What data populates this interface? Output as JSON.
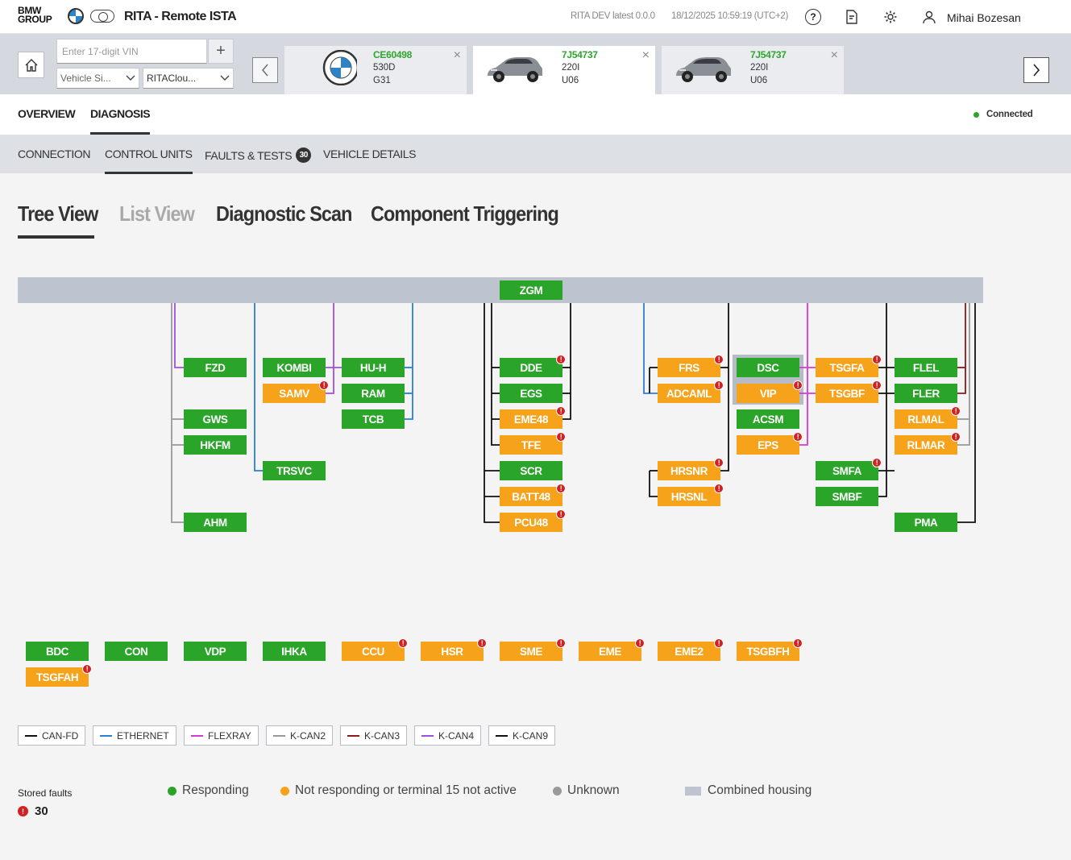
{
  "header": {
    "brand": "BMW\nGROUP",
    "app_title": "RITA - Remote ISTA",
    "environment": "RITA DEV latest 0.0.0",
    "datetime": "18/12/2025 10:59:19 (UTC+2)",
    "user_name": "Mihai Bozesan"
  },
  "vehicle_bar": {
    "vin_placeholder": "Enter 17-digit VIN",
    "add_label": "+",
    "select1": "Vehicle Si...",
    "select2": "RITAClou...",
    "vehicles": [
      {
        "id": "CE60498",
        "line2": "530D",
        "line3": "G31",
        "image": "bmw-logo",
        "active": false
      },
      {
        "id": "7J54737",
        "line2": "220I",
        "line3": "U06",
        "image": "car-photo",
        "active": true
      },
      {
        "id": "7J54737",
        "line2": "220I",
        "line3": "U06",
        "image": "car-photo",
        "active": false
      }
    ]
  },
  "main_tabs": [
    "OVERVIEW",
    "DIAGNOSIS"
  ],
  "connection_status": "Connected",
  "sub_tabs": {
    "connection": "CONNECTION",
    "control_units": "CONTROL UNITS",
    "faults": "FAULTS & TESTS",
    "faults_count": "30",
    "vehicle_details": "VEHICLE DETAILS"
  },
  "view_tabs": [
    "Tree View",
    "List View",
    "Diagnostic Scan",
    "Component Triggering"
  ],
  "tree": {
    "gateway": "ZGM",
    "ecus": [
      {
        "name": "FZD",
        "status": "responding",
        "fault": false
      },
      {
        "name": "GWS",
        "status": "responding",
        "fault": false
      },
      {
        "name": "HKFM",
        "status": "responding",
        "fault": false
      },
      {
        "name": "AHM",
        "status": "responding",
        "fault": false
      },
      {
        "name": "KOMBI",
        "status": "responding",
        "fault": false
      },
      {
        "name": "SAMV",
        "status": "not_responding",
        "fault": true
      },
      {
        "name": "TRSVC",
        "status": "responding",
        "fault": false
      },
      {
        "name": "HU-H",
        "status": "responding",
        "fault": false
      },
      {
        "name": "RAM",
        "status": "responding",
        "fault": false
      },
      {
        "name": "TCB",
        "status": "responding",
        "fault": false
      },
      {
        "name": "DDE",
        "status": "responding",
        "fault": true
      },
      {
        "name": "EGS",
        "status": "responding",
        "fault": false
      },
      {
        "name": "EME48",
        "status": "not_responding",
        "fault": true
      },
      {
        "name": "TFE",
        "status": "not_responding",
        "fault": true
      },
      {
        "name": "SCR",
        "status": "responding",
        "fault": false
      },
      {
        "name": "BATT48",
        "status": "not_responding",
        "fault": true
      },
      {
        "name": "PCU48",
        "status": "not_responding",
        "fault": true
      },
      {
        "name": "FRS",
        "status": "not_responding",
        "fault": true
      },
      {
        "name": "ADCAML",
        "status": "not_responding",
        "fault": true
      },
      {
        "name": "HRSNR",
        "status": "not_responding",
        "fault": true
      },
      {
        "name": "HRSNL",
        "status": "not_responding",
        "fault": true
      },
      {
        "name": "DSC",
        "status": "responding",
        "fault": false
      },
      {
        "name": "VIP",
        "status": "not_responding",
        "fault": true
      },
      {
        "name": "ACSM",
        "status": "responding",
        "fault": false
      },
      {
        "name": "EPS",
        "status": "not_responding",
        "fault": true
      },
      {
        "name": "TSGFA",
        "status": "not_responding",
        "fault": true
      },
      {
        "name": "TSGBF",
        "status": "not_responding",
        "fault": true
      },
      {
        "name": "SMFA",
        "status": "responding",
        "fault": true
      },
      {
        "name": "SMBF",
        "status": "responding",
        "fault": false
      },
      {
        "name": "FLEL",
        "status": "responding",
        "fault": false
      },
      {
        "name": "FLER",
        "status": "responding",
        "fault": false
      },
      {
        "name": "RLMAL",
        "status": "not_responding",
        "fault": true
      },
      {
        "name": "RLMAR",
        "status": "not_responding",
        "fault": true
      },
      {
        "name": "PMA",
        "status": "responding",
        "fault": false
      }
    ],
    "unconnected": [
      {
        "name": "BDC",
        "status": "responding",
        "fault": false
      },
      {
        "name": "CON",
        "status": "responding",
        "fault": false
      },
      {
        "name": "VDP",
        "status": "responding",
        "fault": false
      },
      {
        "name": "IHKA",
        "status": "responding",
        "fault": false
      },
      {
        "name": "CCU",
        "status": "not_responding",
        "fault": true
      },
      {
        "name": "HSR",
        "status": "not_responding",
        "fault": true
      },
      {
        "name": "SME",
        "status": "not_responding",
        "fault": true
      },
      {
        "name": "EME",
        "status": "not_responding",
        "fault": true
      },
      {
        "name": "EME2",
        "status": "not_responding",
        "fault": true
      },
      {
        "name": "TSGBFH",
        "status": "not_responding",
        "fault": true
      },
      {
        "name": "TSGFAH",
        "status": "not_responding",
        "fault": true
      }
    ]
  },
  "bus_legend": [
    {
      "label": "CAN-FD",
      "color": "#111111"
    },
    {
      "label": "ETHERNET",
      "color": "#2a7fd6"
    },
    {
      "label": "FLEXRAY",
      "color": "#d63ad6"
    },
    {
      "label": "K-CAN2",
      "color": "#999999"
    },
    {
      "label": "K-CAN3",
      "color": "#8a1a1a"
    },
    {
      "label": "K-CAN4",
      "color": "#a24ee0"
    },
    {
      "label": "K-CAN9",
      "color": "#111111"
    }
  ],
  "status_legend": [
    {
      "label": "Responding",
      "color": "#2aa52a"
    },
    {
      "label": "Not responding or terminal 15 not active",
      "color": "#f7a21b"
    },
    {
      "label": "Unknown",
      "color": "#999999"
    },
    {
      "label": "Combined housing",
      "color": "#bdc4cf"
    }
  ],
  "stored_faults": {
    "label": "Stored faults",
    "count": "30"
  },
  "colors": {
    "responding": "#2aa52a",
    "not_responding": "#f7a21b",
    "error": "#d42020",
    "bus_bar": "#bdc4cf"
  }
}
